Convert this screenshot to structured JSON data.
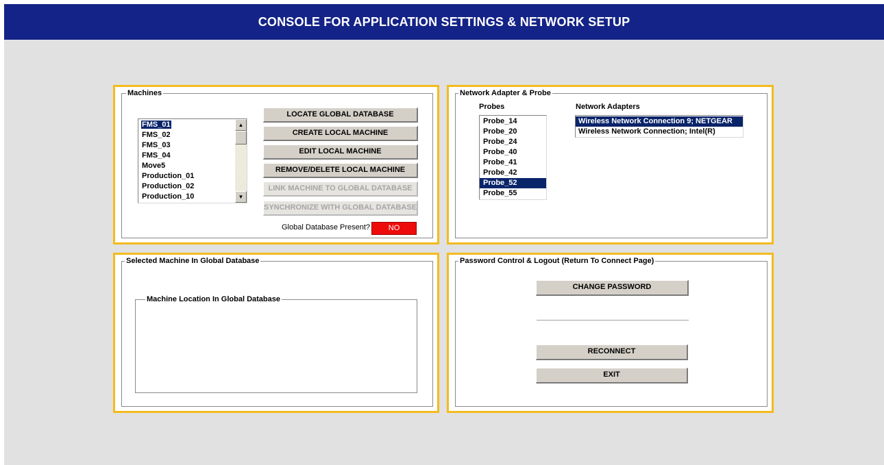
{
  "window": {
    "title": "CONSOLE FOR APPLICATION SETTINGS & NETWORK SETUP"
  },
  "machines_panel": {
    "label": "Machines",
    "items": [
      "FMS_01",
      "FMS_02",
      "FMS_03",
      "FMS_04",
      "Move5",
      "Production_01",
      "Production_02",
      "Production_10"
    ],
    "selected": "FMS_01",
    "buttons": {
      "locate": "LOCATE GLOBAL DATABASE",
      "create": "CREATE LOCAL MACHINE",
      "edit": "EDIT LOCAL MACHINE",
      "remove": "REMOVE/DELETE LOCAL MACHINE",
      "link": "LINK MACHINE TO GLOBAL DATABASE",
      "sync": "SYNCHRONIZE WITH GLOBAL DATABASE"
    },
    "global_db_label": "Global Database Present?",
    "global_db_status": "NO",
    "global_db_status_color": "#ee0b0b"
  },
  "network_panel": {
    "label": "Network Adapter & Probe",
    "probes_label": "Probes",
    "probes": [
      "Probe_14",
      "Probe_20",
      "Probe_24",
      "Probe_40",
      "Probe_41",
      "Probe_42",
      "Probe_52",
      "Probe_55"
    ],
    "selected_probe": "Probe_52",
    "adapters_label": "Network Adapters",
    "adapters": [
      "Wireless Network Connection 9; NETGEAR",
      "Wireless Network Connection; Intel(R)"
    ],
    "selected_adapter": "Wireless Network Connection 9; NETGEAR"
  },
  "selected_machine_panel": {
    "label": "Selected Machine In Global Database",
    "location_label": "Machine Location In Global Database"
  },
  "password_panel": {
    "label": "Password Control & Logout (Return To Connect Page)",
    "change_password": "CHANGE PASSWORD",
    "reconnect": "RECONNECT",
    "exit": "EXIT"
  },
  "colors": {
    "title_bar": "#142387",
    "panel_border": "#f3bb1d",
    "selection": "#0a246a",
    "background": "#e1e1e1"
  }
}
